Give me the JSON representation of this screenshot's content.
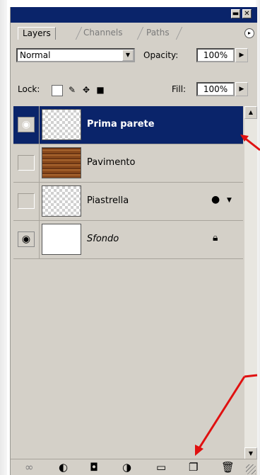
{
  "window": {
    "minimize_icon": "minimize-icon",
    "close_icon": "close-icon"
  },
  "tabs": [
    {
      "label": "Layers",
      "active": true
    },
    {
      "label": "Channels",
      "active": false
    },
    {
      "label": "Paths",
      "active": false
    }
  ],
  "controls": {
    "blend_mode": "Normal",
    "opacity_label": "Opacity:",
    "opacity_value": "100%",
    "lock_label": "Lock:",
    "fill_label": "Fill:",
    "fill_value": "100%"
  },
  "layers": [
    {
      "name": "Prima parete",
      "visible": true,
      "selected": true,
      "thumbnail": "transparent"
    },
    {
      "name": "Pavimento",
      "visible": false,
      "selected": false,
      "thumbnail": "wood-texture"
    },
    {
      "name": "Piastrella",
      "visible": false,
      "selected": false,
      "thumbnail": "transparent",
      "badge_icon": "layer-style-icon"
    },
    {
      "name": "Sfondo",
      "visible": true,
      "selected": false,
      "thumbnail": "white",
      "badge_icon": "lock-icon"
    }
  ],
  "bottom_icons": [
    "link-icon",
    "layer-style-icon",
    "mask-icon",
    "adjustment-layer-icon",
    "new-group-icon",
    "new-layer-icon",
    "trash-icon"
  ],
  "colors": {
    "selection": "#0a246a",
    "panel": "#d4d0c8",
    "annotation_arrow": "#e01010"
  }
}
